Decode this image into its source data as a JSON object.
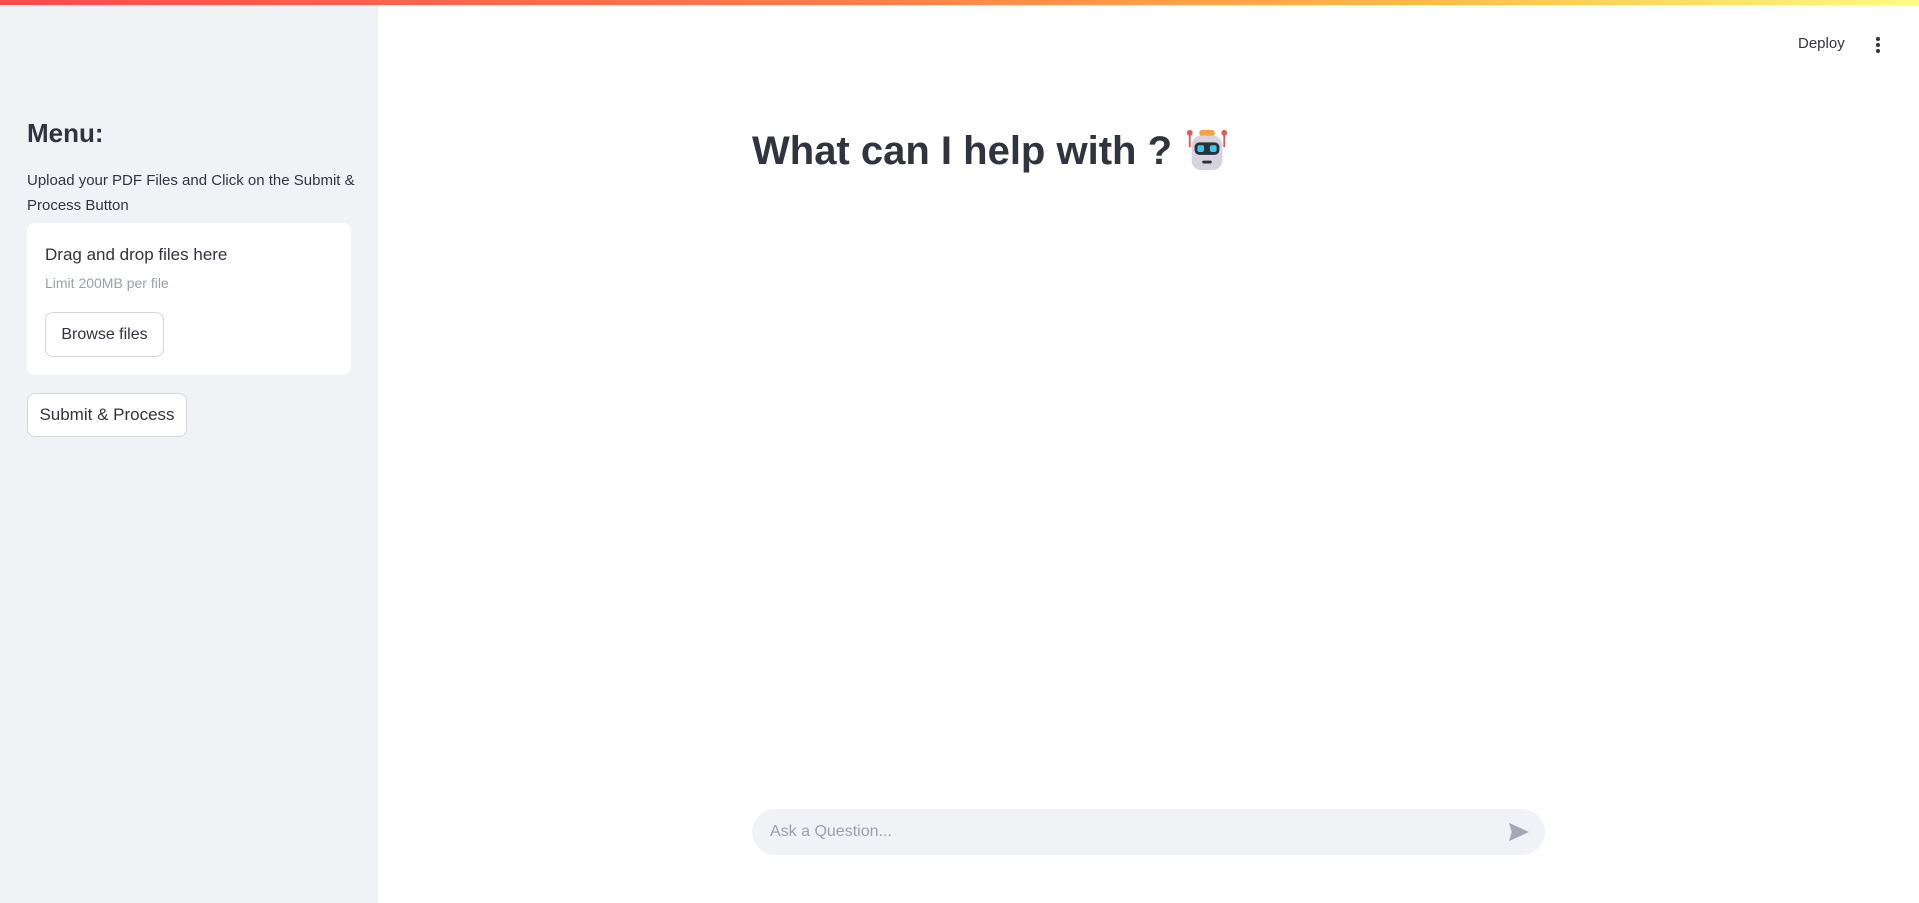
{
  "header": {
    "deploy_label": "Deploy",
    "menu_icon": "kebab-menu-icon"
  },
  "sidebar": {
    "title": "Menu:",
    "description": "Upload your PDF Files and Click on the Submit & Process Button",
    "uploader": {
      "title": "Drag and drop files here",
      "limit": "Limit 200MB per file",
      "browse_label": "Browse files"
    },
    "submit_label": "Submit & Process"
  },
  "main": {
    "heading": "What can I help with ?",
    "heading_icon": "robot-icon"
  },
  "chat": {
    "placeholder": "Ask a Question...",
    "send_icon": "send-icon"
  },
  "colors": {
    "accent": "#ff4b4b",
    "sidebar_bg": "#f0f2f6",
    "text": "#31333f",
    "muted": "#9aa0ab"
  }
}
